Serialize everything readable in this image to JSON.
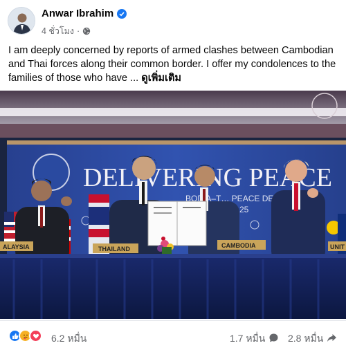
{
  "post": {
    "author": "Anwar Ibrahim",
    "time": "4 ชั่วโมง",
    "separator": "·",
    "text": "I am deeply concerned by reports of armed clashes between Cambodian and Thai forces along their common border. I offer my condolences to the families of those who have ...",
    "see_more": "ดูเพิ่มเติม"
  },
  "photo": {
    "banner_text": "DELIVERING PEACE",
    "banner_sub": "BODIA–T… PEACE DEA…",
    "banner_year": "25",
    "flag_labels": [
      "ALAYSIA",
      "THAILAND",
      "CAMBODIA",
      "UNIT"
    ]
  },
  "stats": {
    "reactions": "6.2 หมื่น",
    "comments": "1.7 หมื่น",
    "shares": "2.8 หมื่น"
  },
  "colors": {
    "facebook_blue": "#1877f2",
    "like_blue": "#1877f2",
    "love_red": "#f33e58",
    "care_yellow": "#f7b125"
  }
}
